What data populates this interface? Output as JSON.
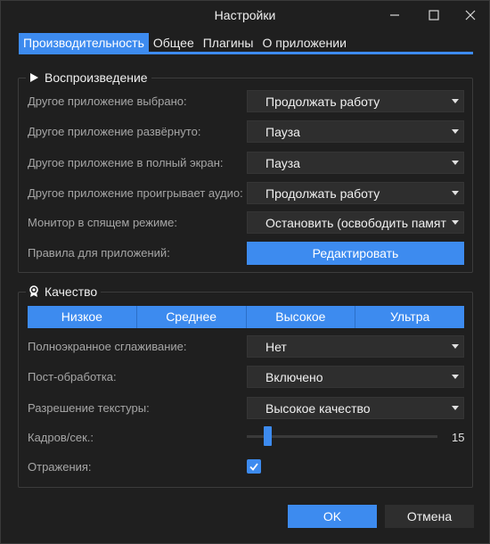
{
  "window": {
    "title": "Настройки",
    "controls": [
      "minimize-icon",
      "maximize-icon",
      "close-icon"
    ]
  },
  "tabs": [
    {
      "label": "Производительность",
      "active": true
    },
    {
      "label": "Общее",
      "active": false
    },
    {
      "label": "Плагины",
      "active": false
    },
    {
      "label": "О приложении",
      "active": false
    }
  ],
  "playback": {
    "title": "Воспроизведение",
    "icon": "play-icon",
    "rows": [
      {
        "label": "Другое приложение выбрано:",
        "value": "Продолжать работу"
      },
      {
        "label": "Другое приложение развёрнуто:",
        "value": "Пауза"
      },
      {
        "label": "Другое приложение в полный экран:",
        "value": "Пауза"
      },
      {
        "label": "Другое приложение проигрывает аудио:",
        "value": "Продолжать работу"
      },
      {
        "label": "Монитор в спящем режиме:",
        "value": "Остановить (освободить памят"
      }
    ],
    "rules_label": "Правила для приложений:",
    "edit_button": "Редактировать"
  },
  "quality": {
    "title": "Качество",
    "icon": "award-icon",
    "presets": [
      "Низкое",
      "Среднее",
      "Высокое",
      "Ультра"
    ],
    "antialias_label": "Полноэкранное сглаживание:",
    "antialias_value": "Нет",
    "postprocess_label": "Пост-обработка:",
    "postprocess_value": "Включено",
    "texture_label": "Разрешение текстуры:",
    "texture_value": "Высокое качество",
    "fps_label": "Кадров/сек.:",
    "fps_value": "15",
    "reflections_label": "Отражения:",
    "reflections_checked": true
  },
  "buttons": {
    "ok": "OK",
    "cancel": "Отмена"
  },
  "colors": {
    "accent": "#3d8bef",
    "background": "#1f1f1f",
    "combo_bg": "#2e2e2e"
  }
}
